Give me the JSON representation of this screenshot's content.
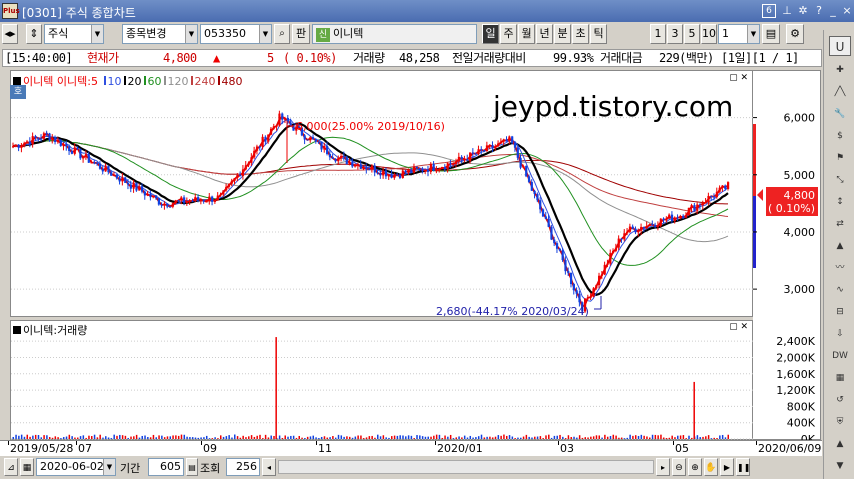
{
  "window": {
    "app_icon": "Plus",
    "title": "[0301] 주식 종합차트",
    "box_number": "6",
    "controls": [
      "pin-icon",
      "snowflake-icon",
      "help-icon",
      "minimize-icon",
      "close-icon"
    ]
  },
  "toolbar": {
    "market_type": "주식",
    "change_item_label": "종목변경",
    "code": "053350",
    "pan_label": "판",
    "sin_badge": "신",
    "stock_name": "이니텍",
    "periods": [
      "일",
      "주",
      "월",
      "년",
      "분",
      "초",
      "틱"
    ],
    "active_period": "일",
    "intervals": [
      "1",
      "3",
      "5",
      "10"
    ],
    "interval_value": "1"
  },
  "infobar": {
    "time": "[15:40:00]",
    "price_label": "현재가",
    "price": "4,800",
    "change_arrow": "▲",
    "change": "5",
    "change_pct": "( 0.10%)",
    "volume_label": "거래량",
    "volume": "48,258",
    "prev_volume_label": "전일거래량대비",
    "prev_volume_ratio": "99.93%",
    "amount_label": "거래대금",
    "amount": "229(백만)",
    "page": "[1일][1 / 1]"
  },
  "legend": {
    "name": "이니텍",
    "ma_label": "이니텍:5",
    "ma": [
      "10",
      "20",
      "60",
      "120",
      "240",
      "480"
    ],
    "colors": {
      "5": "#e00000",
      "10": "#3050e0",
      "20": "#000000",
      "60": "#209020",
      "120": "#909090",
      "240": "#c04040",
      "480": "#a00000"
    }
  },
  "watermark": "jeypd.tistory.com",
  "annotations": {
    "high": "6,000(25.00% 2019/10/16)",
    "low": "2,680(-44.17% 2020/03/24)"
  },
  "price_axis": {
    "ticks": [
      "6,000",
      "5,000",
      "4,000",
      "3,000"
    ],
    "current": "4,800",
    "current_pct": "( 0.10%)"
  },
  "volume_panel": {
    "label": "이니텍:거래량",
    "ticks": [
      "2,400K",
      "2,000K",
      "1,600K",
      "1,200K",
      "800K",
      "400K",
      "0K"
    ]
  },
  "x_axis": {
    "labels": [
      "2019/05/28",
      "07",
      "09",
      "11",
      "2020/01",
      "03",
      "05",
      "2020/06/09"
    ]
  },
  "bottom": {
    "date": "2020-06-02",
    "period_label": "기간",
    "period_value": "605",
    "query_label": "조회",
    "query_value": "256"
  },
  "chart_data": {
    "type": "candlestick",
    "title": "",
    "series": [
      {
        "name": "이니텍",
        "points": [
          [
            "2019/05/28",
            5500
          ],
          [
            "2019/06",
            5700
          ],
          [
            "2019/07",
            5100
          ],
          [
            "2019/08",
            4500
          ],
          [
            "2019/09",
            4600
          ],
          [
            "2019/10/16",
            6000
          ],
          [
            "2019/11",
            5300
          ],
          [
            "2019/12",
            5000
          ],
          [
            "2020/01",
            5200
          ],
          [
            "2020/02",
            5600
          ],
          [
            "2020/03/24",
            2680
          ],
          [
            "2020/04",
            4000
          ],
          [
            "2020/05",
            4300
          ],
          [
            "2020/06/09",
            4800
          ]
        ]
      },
      {
        "name": "이니텍:5",
        "values": "moving average 5"
      },
      {
        "name": "10",
        "values": "moving average 10"
      },
      {
        "name": "20",
        "values": "moving average 20"
      },
      {
        "name": "60",
        "values": "moving average 60"
      },
      {
        "name": "120",
        "values": "moving average 120"
      },
      {
        "name": "240",
        "values": "moving average 240"
      },
      {
        "name": "480",
        "values": "moving average 480"
      }
    ],
    "volume_spikes": [
      [
        "2019/10/14",
        2500000
      ],
      [
        "2020/05/22",
        1400000
      ]
    ],
    "ylim": [
      2600,
      6500
    ],
    "volume_ylim": [
      0,
      2600000
    ]
  }
}
